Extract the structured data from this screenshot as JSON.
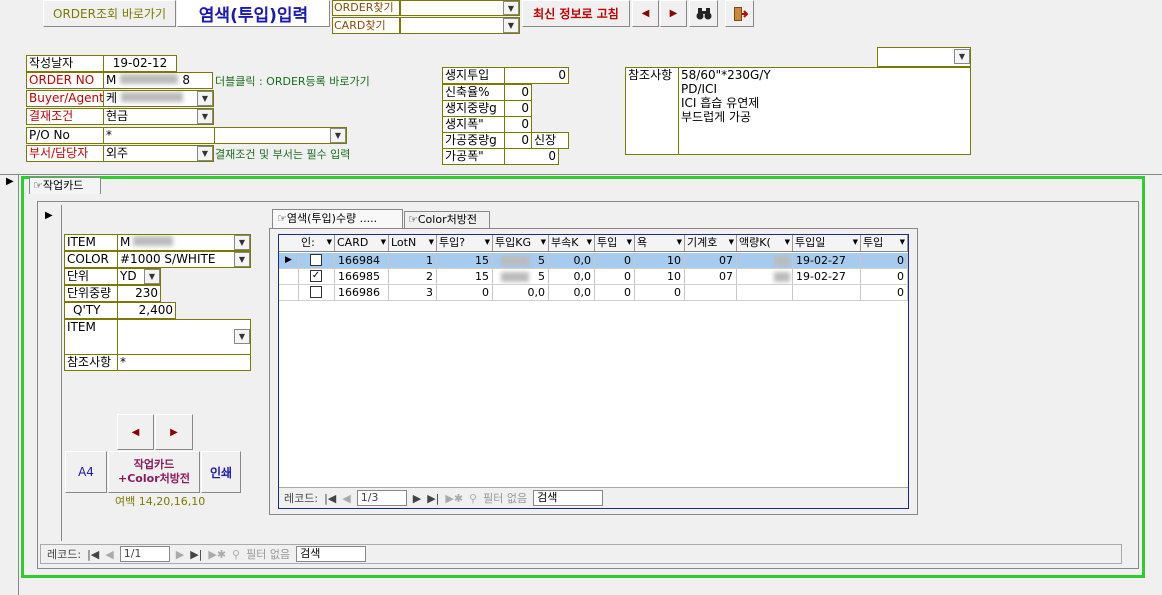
{
  "toolbar": {
    "order_link": "ORDER조회 바로가기",
    "title": "염색(투입)입력",
    "order_find": "ORDER찾기",
    "card_find": "CARD찾기",
    "refresh": "최신 정보로 고침",
    "prev": "◀",
    "next": "▶",
    "find_icon": "binoculars-icon",
    "exit_icon": "exit-door-icon"
  },
  "header": {
    "date_label": "작성날자",
    "date_value": "19-02-12",
    "order_label": "ORDER NO",
    "order_value": "M",
    "order_value_end": "8",
    "order_hint": "더블클릭 : ORDER등록 바로가기",
    "buyer_label": "Buyer/Agent",
    "buyer_value": "케",
    "payment_label": "결재조건",
    "payment_value": "현금",
    "po_label": "P/O No",
    "po_value": "*",
    "dept_label": "부서/담당자",
    "dept_value": "외주",
    "required_hint": "결재조건 및 부서는 필수 입력"
  },
  "metrics": [
    {
      "label": "생지투입",
      "value": "0"
    },
    {
      "label": "신축율%",
      "value": "0"
    },
    {
      "label": "생지중량g",
      "value": "0"
    },
    {
      "label": "생지폭\"",
      "value": "0"
    },
    {
      "label": "가공중량g",
      "value": "0",
      "extra": "신장"
    },
    {
      "label": "가공폭\"",
      "value": "0"
    }
  ],
  "notes": {
    "label": "참조사항",
    "lines": [
      "58/60\"*230G/Y",
      "PD/ICI",
      "ICI 흡습 유연제",
      "부드럽게 가공"
    ]
  },
  "card_tab": "작업카드",
  "item": {
    "item_label": "ITEM",
    "item_value": "M",
    "color_label": "COLOR",
    "color_value": "#1000 S/WHITE",
    "unit_label": "단위",
    "unit_value": "YD",
    "unit_weight_label": "단위중량",
    "unit_weight_value": "230",
    "qty_label": "Q'TY",
    "qty_value": "2,400",
    "item2_label": "ITEM",
    "ref_label": "참조사항",
    "ref_value": "*"
  },
  "buttons": {
    "prev": "◀",
    "next": "▶",
    "a4": "A4",
    "work_card_line1": "작업카드",
    "work_card_line2": "+Color처방전",
    "print": "인쇄",
    "margin": "여백 14,20,16,10"
  },
  "subtabs": [
    "염색(투입)수량 .....",
    "Color처방전"
  ],
  "grid": {
    "columns": [
      "인:",
      "CARD",
      "LotN",
      "투입?",
      "투입KG",
      "부속K",
      "투입",
      "욕",
      "기계호",
      "액량K(",
      "투입일",
      "투입"
    ],
    "rows": [
      {
        "checked": false,
        "card": "166984",
        "lot": "1",
        "in": "15",
        "kg": "5",
        "sub": "0,0",
        "t": "0",
        "bath": "10",
        "machine": "07",
        "liq": "",
        "date": "19-02-27",
        "last": "0"
      },
      {
        "checked": true,
        "card": "166985",
        "lot": "2",
        "in": "15",
        "kg": "5",
        "sub": "0,0",
        "t": "0",
        "bath": "10",
        "machine": "07",
        "liq": "",
        "date": "19-02-27",
        "last": "0"
      },
      {
        "checked": false,
        "card": "166986",
        "lot": "3",
        "in": "0",
        "kg": "0,0",
        "sub": "0,0",
        "t": "0",
        "bath": "0",
        "machine": "",
        "liq": "",
        "date": "",
        "last": "0"
      }
    ]
  },
  "inner_nav": {
    "label": "레코드:",
    "pos": "1/3",
    "filter": "필터 없음",
    "search": "검색"
  },
  "outer_nav": {
    "label": "레코드:",
    "pos": "1/1",
    "filter": "필터 없음",
    "search": "검색"
  }
}
